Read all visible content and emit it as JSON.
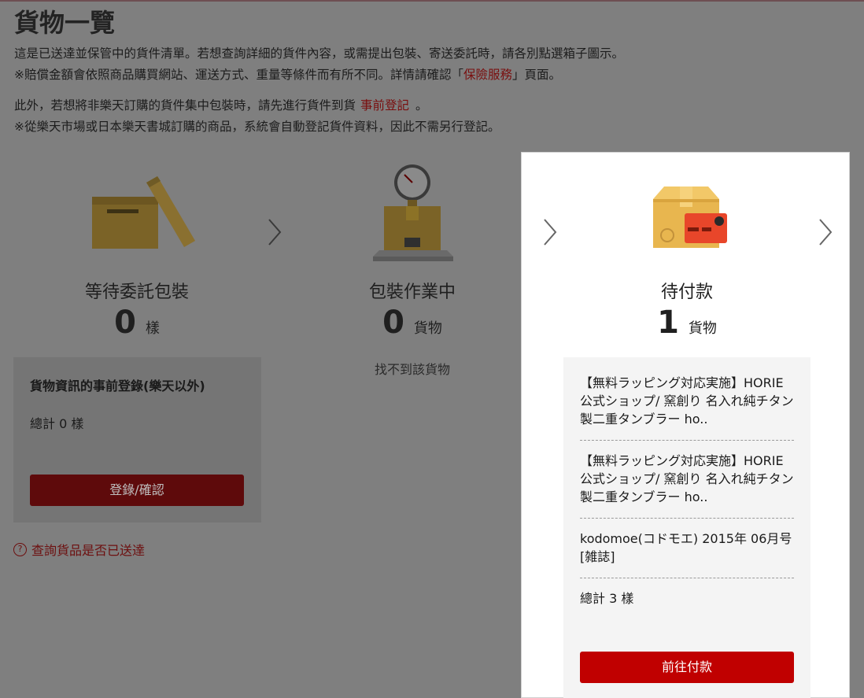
{
  "page": {
    "title": "貨物一覽",
    "intro_line1": "這是已送達並保管中的貨件清單。若想查詢詳細的貨件內容，或需提出包裝、寄送委託時，請各別點選箱子圖示。",
    "intro_line2_pre": "※賠償金額會依照商品購買網站、運送方式、重量等條件而有所不同。詳情請確認「",
    "intro_line2_link": "保險服務",
    "intro_line2_post": "」頁面。",
    "intro_line3_pre": "此外，若想將非樂天訂購的貨件集中包裝時，請先進行貨件到貨",
    "intro_line3_link": "事前登記",
    "intro_line3_post": "。",
    "intro_line4": "※從樂天市場或日本樂天書城訂購的商品，系統會自動登記貨件資料，因此不需另行登記。"
  },
  "steps": [
    {
      "title": "等待委託包裝",
      "count": "0",
      "unit": "樣",
      "icon": "open-box-icon"
    },
    {
      "title": "包裝作業中",
      "count": "0",
      "unit": "貨物",
      "icon": "scale-box-icon"
    },
    {
      "title": "待付款",
      "count": "1",
      "unit": "貨物",
      "icon": "box-credit-card-icon"
    }
  ],
  "pre_register": {
    "heading": "貨物資訊的事前登錄(樂天以外)",
    "total": "總計 0 樣",
    "button": "登錄/確認"
  },
  "help_link": "查詢貨品是否已送達",
  "packing_empty": "找不到該貨物",
  "payment": {
    "items": [
      "【無料ラッピング対応実施】HORIE 公式ショップ/ 窯創り 名入れ純チタン製二重タンブラー ho..",
      "【無料ラッピング対応実施】HORIE 公式ショップ/ 窯創り 名入れ純チタン製二重タンブラー ho..",
      "kodomoe(コドモエ) 2015年 06月号 [雑誌]"
    ],
    "total": "總計 3 樣",
    "button": "前往付款"
  },
  "colors": {
    "overlay_bg": "#7f7f7f",
    "link_dark_red": "#7a0e0e",
    "button_red": "#c00000",
    "button_dark": "#5e0a0b"
  }
}
